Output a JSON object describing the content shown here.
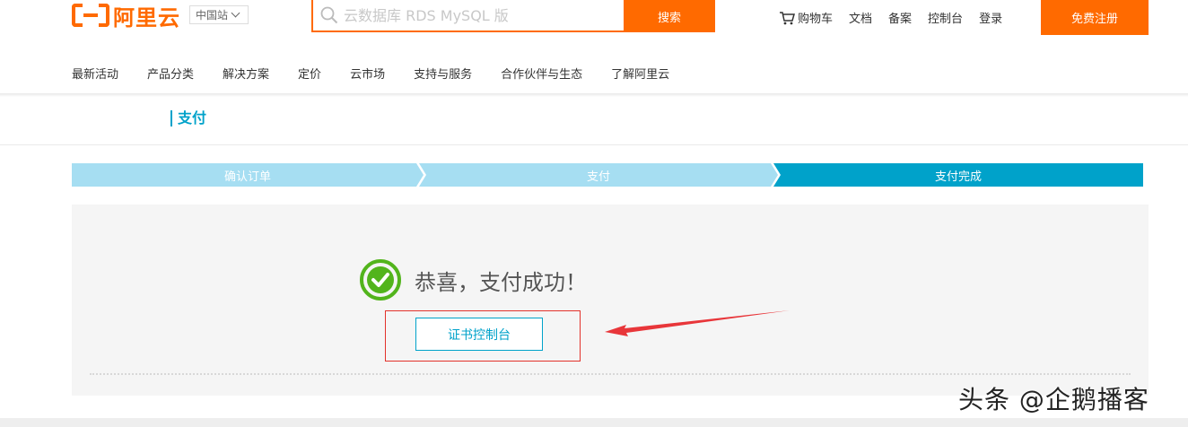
{
  "header": {
    "logo_text": "阿里云",
    "region_label": "中国站",
    "search": {
      "placeholder": "云数据库 RDS MySQL 版",
      "button_label": "搜索"
    },
    "top_nav": [
      "购物车",
      "文档",
      "备案",
      "控制台",
      "登录"
    ],
    "signup_label": "免费注册"
  },
  "main_nav": [
    "最新活动",
    "产品分类",
    "解决方案",
    "定价",
    "云市场",
    "支持与服务",
    "合作伙伴与生态",
    "了解阿里云"
  ],
  "section_title": "支付",
  "steps": [
    {
      "label": "确认订单",
      "state": "done"
    },
    {
      "label": "支付",
      "state": "done"
    },
    {
      "label": "支付完成",
      "state": "current"
    }
  ],
  "result": {
    "message": "恭喜，支付成功！",
    "cert_console_button": "证书控制台"
  },
  "colors": {
    "brand": "#ff6a00",
    "accent": "#00a2ca",
    "success": "#52b41c",
    "annotation": "#e3322b"
  },
  "icons": {
    "logo": "aliyun-logo-icon",
    "search": "search-icon",
    "cart": "cart-icon",
    "success": "check-circle-icon",
    "arrow": "red-arrow-icon"
  },
  "watermark": "头条 @企鹅播客"
}
